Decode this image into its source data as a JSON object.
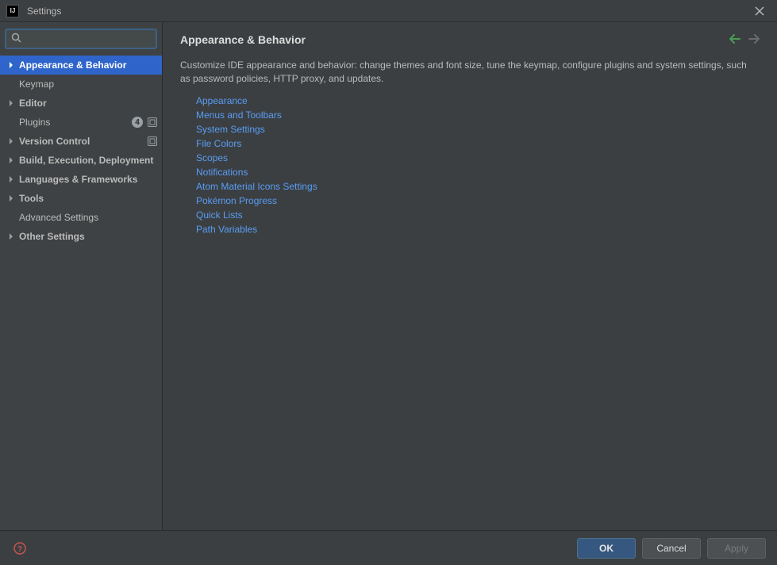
{
  "window": {
    "title": "Settings"
  },
  "search": {
    "value": ""
  },
  "sidebar": {
    "items": [
      {
        "label": "Appearance & Behavior",
        "expandable": true,
        "depth": 1,
        "selected": true
      },
      {
        "label": "Keymap",
        "expandable": false,
        "depth": 2,
        "selected": false
      },
      {
        "label": "Editor",
        "expandable": true,
        "depth": 1,
        "selected": false
      },
      {
        "label": "Plugins",
        "expandable": false,
        "depth": 2,
        "selected": false,
        "badge_count": "4",
        "badge_icon": true
      },
      {
        "label": "Version Control",
        "expandable": true,
        "depth": 1,
        "selected": false,
        "badge_icon": true
      },
      {
        "label": "Build, Execution, Deployment",
        "expandable": true,
        "depth": 1,
        "selected": false
      },
      {
        "label": "Languages & Frameworks",
        "expandable": true,
        "depth": 1,
        "selected": false
      },
      {
        "label": "Tools",
        "expandable": true,
        "depth": 1,
        "selected": false
      },
      {
        "label": "Advanced Settings",
        "expandable": false,
        "depth": 2,
        "selected": false
      },
      {
        "label": "Other Settings",
        "expandable": true,
        "depth": 1,
        "selected": false
      }
    ]
  },
  "main": {
    "title": "Appearance & Behavior",
    "description": "Customize IDE appearance and behavior: change themes and font size, tune the keymap, configure plugins and system settings, such as password policies, HTTP proxy, and updates.",
    "links": [
      "Appearance",
      "Menus and Toolbars",
      "System Settings",
      "File Colors",
      "Scopes",
      "Notifications",
      "Atom Material Icons Settings",
      "Pokémon Progress",
      "Quick Lists",
      "Path Variables"
    ]
  },
  "footer": {
    "ok": "OK",
    "cancel": "Cancel",
    "apply": "Apply"
  }
}
